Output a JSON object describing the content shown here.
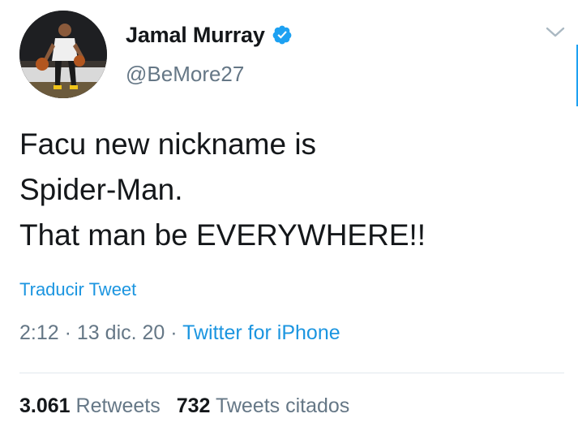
{
  "tweet": {
    "author": {
      "display_name": "Jamal Murray",
      "handle": "@BeMore27",
      "verified": true,
      "avatar_icon": "player-avatar"
    },
    "menu_icon": "chevron-down-icon",
    "text": "Facu new nickname is\nSpider-Man.\nThat man be EVERYWHERE!!",
    "translate_label": "Traducir Tweet",
    "time": "2:12",
    "separator": "·",
    "date": "13 dic. 20",
    "source": "Twitter for iPhone",
    "stats": {
      "retweets_count": "3.061",
      "retweets_label": "Retweets",
      "quotes_count": "732",
      "quotes_label": "Tweets citados"
    }
  },
  "colors": {
    "text": "#14171a",
    "secondary": "#657786",
    "accent": "#1b95e0",
    "verified": "#1da1f2",
    "divider": "#e1e8ed"
  }
}
